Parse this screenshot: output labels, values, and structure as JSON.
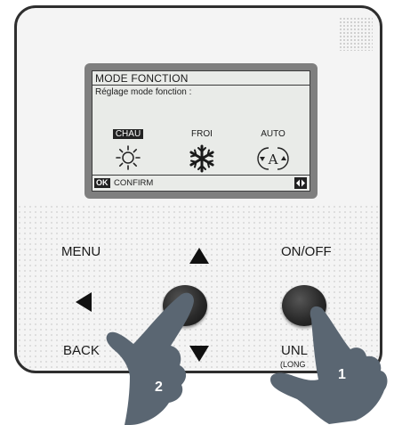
{
  "colors": {
    "bezel": "#2e2e2e",
    "lcd_frame": "#7f7f7f",
    "lcd_screen": "#e9ebe8",
    "hand": "#5a6672",
    "button": "#2a2a2a"
  },
  "lcd": {
    "title": "MODE FONCTION",
    "subtitle": "Réglage mode fonction :",
    "modes": [
      {
        "label": "CHAU",
        "icon": "sun-icon",
        "selected": true
      },
      {
        "label": "FROI",
        "icon": "snowflake-icon",
        "selected": false
      },
      {
        "label": "AUTO",
        "icon": "auto-mode-icon",
        "selected": false
      }
    ],
    "ok_badge": "OK",
    "confirm": "CONFIRM",
    "nav_icon": "left-right-arrows-icon"
  },
  "buttons": {
    "menu": "MENU",
    "on_off": "ON/OFF",
    "back": "BACK",
    "unlock": "UNL",
    "unlock_sub": "(LONG"
  },
  "callouts": {
    "left": "2",
    "right": "1"
  }
}
